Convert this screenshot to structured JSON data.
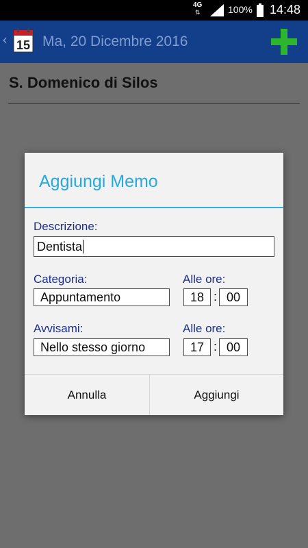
{
  "status_bar": {
    "network": "4G",
    "battery": "100%",
    "time": "14:48"
  },
  "action_bar": {
    "date": "Ma, 20 Dicembre 2016",
    "calendar_day": "15",
    "back_icon": "chevron-left-icon",
    "add_icon": "plus-icon",
    "add_color": "#2db52d"
  },
  "content": {
    "saint": "S. Domenico di Silos"
  },
  "dialog": {
    "title": "Aggiungi Memo",
    "description_label": "Descrizione:",
    "description_value": "Dentista",
    "category_label": "Categoria:",
    "category_value": "Appuntamento",
    "time_label_1": "Alle ore:",
    "time_1_hour": "18",
    "time_1_minute": "00",
    "remind_label": "Avvisami:",
    "remind_value": "Nello stesso giorno",
    "time_label_2": "Alle ore:",
    "time_2_hour": "17",
    "time_2_minute": "00",
    "colon": ":",
    "cancel_label": "Annulla",
    "add_label": "Aggiungi"
  }
}
